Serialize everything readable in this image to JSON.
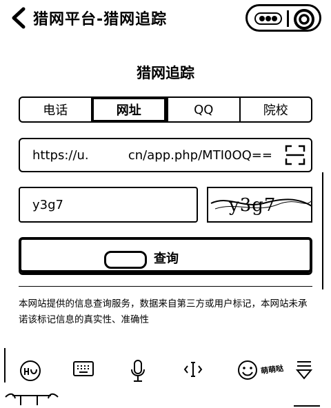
{
  "header": {
    "title": "猎网平台-猎网追踪",
    "back_icon": "chevron-left-icon",
    "more_icon": "more-dots-icon",
    "close_icon": "target-close-icon"
  },
  "page": {
    "title": "猎网追踪"
  },
  "tabs": [
    {
      "label": "电话",
      "active": false
    },
    {
      "label": "网址",
      "active": true
    },
    {
      "label": "QQ",
      "active": false
    },
    {
      "label": "院校",
      "active": false
    }
  ],
  "url_field": {
    "value": "https://u.          cn/app.php/MTI0OQ==",
    "scan_icon": "scan-icon"
  },
  "captcha_field": {
    "value": "y3g7"
  },
  "captcha_image": {
    "text": "y3g7"
  },
  "query_button": {
    "label": "查询"
  },
  "disclaimer": "本网站提供的信息查询服务，数据来自第三方或用户标记，本网站未承诺该标记信息的真实性、准确性",
  "keyboard_toolbar": {
    "items": [
      "input-method-icon",
      "keyboard-icon",
      "microphone-icon",
      "cursor-move-icon",
      "emoji-icon",
      "collapse-keyboard-icon"
    ],
    "emoji_caption": "萌萌哒"
  }
}
